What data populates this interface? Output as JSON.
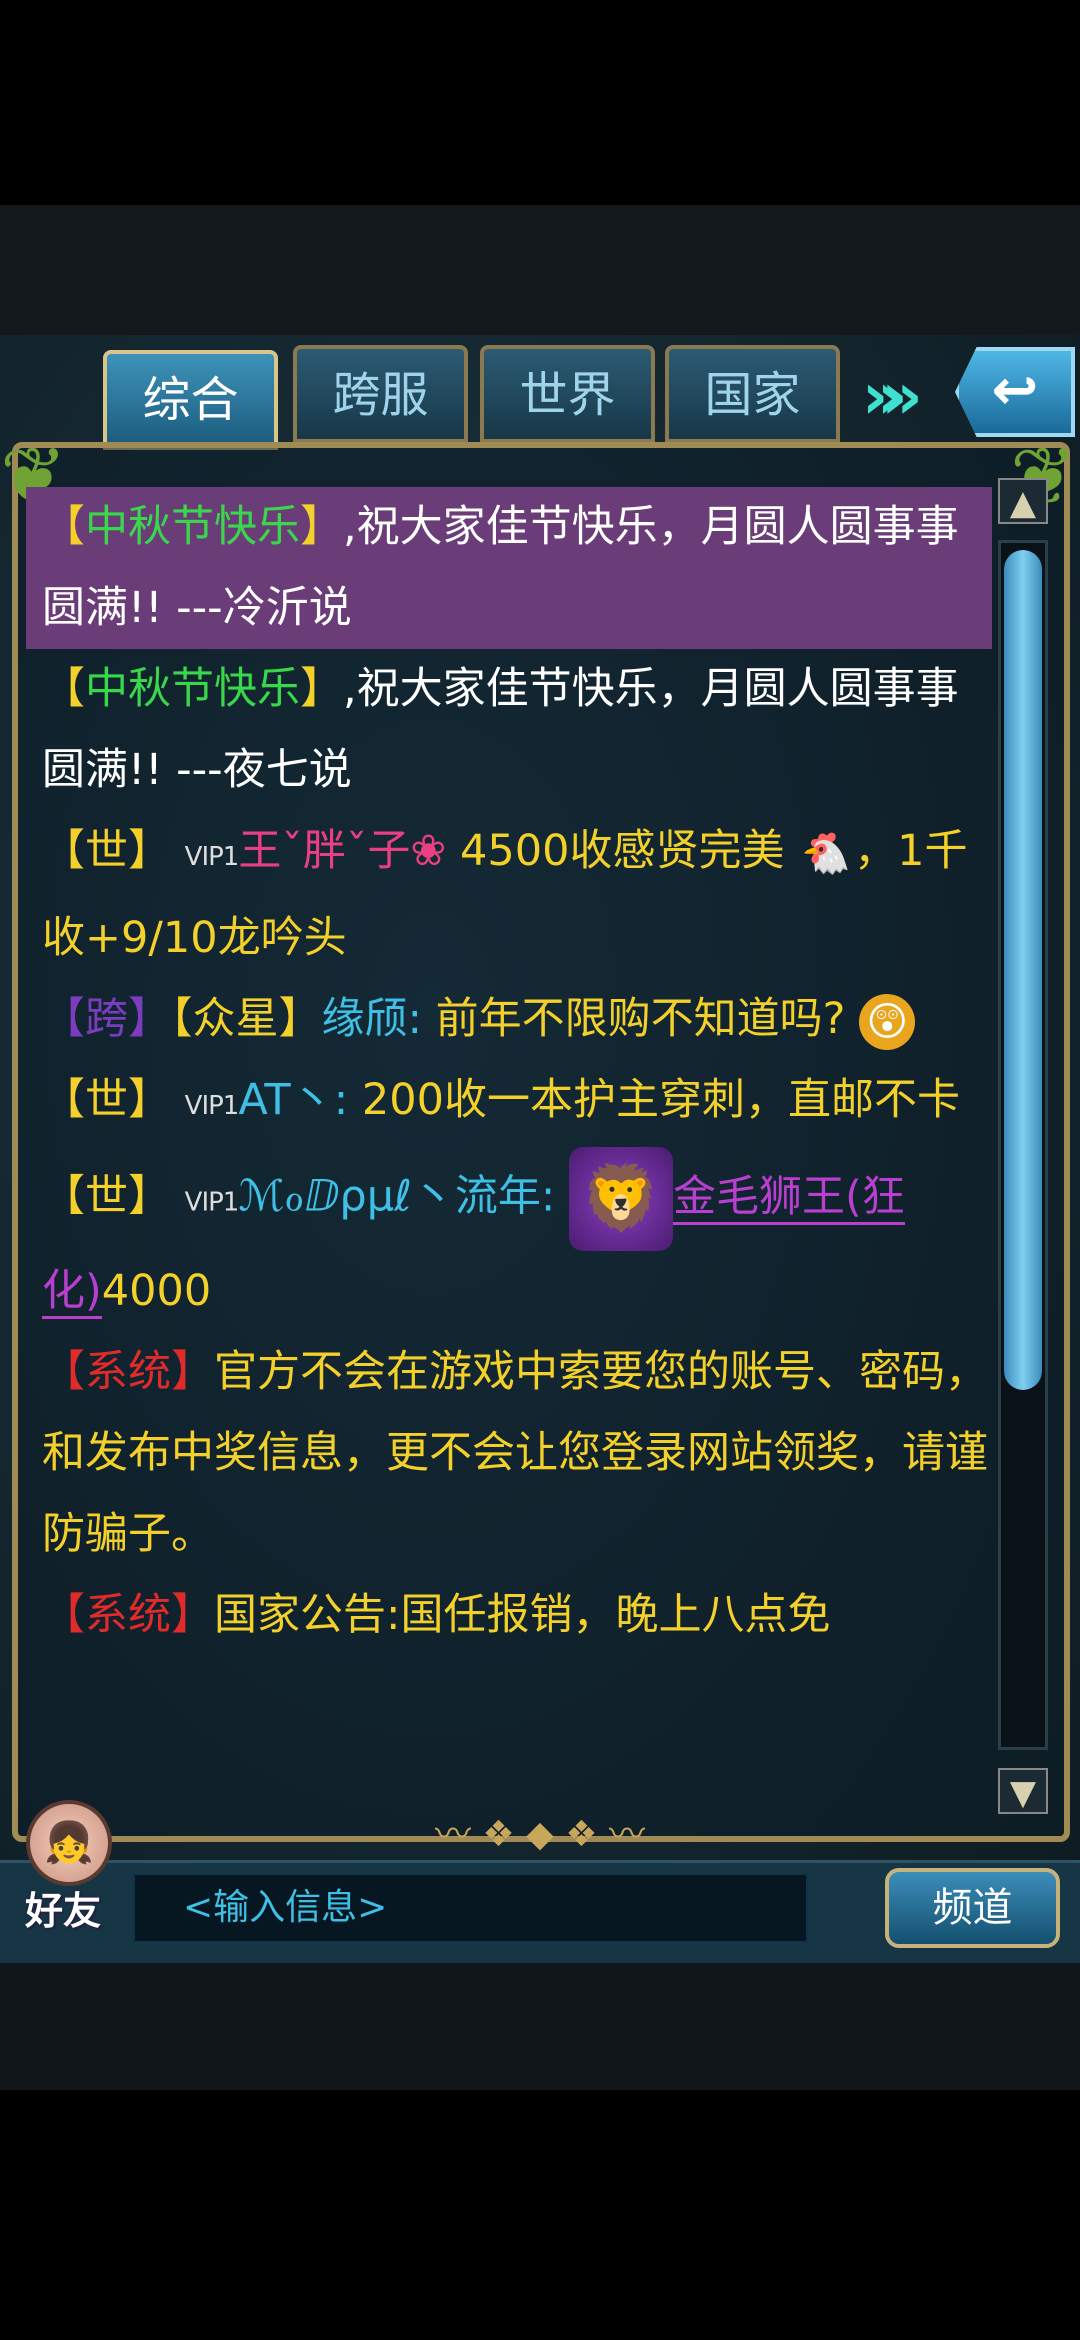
{
  "tabs": [
    {
      "label": "综合",
      "active": true
    },
    {
      "label": "跨服",
      "active": false
    },
    {
      "label": "世界",
      "active": false
    },
    {
      "label": "国家",
      "active": false
    }
  ],
  "header": {
    "arrows_icon": "double-chevron-right",
    "back_icon": "return-arrow"
  },
  "messages": [
    {
      "tag": "【中秋节快乐】",
      "rest": ",祝大家佳节快乐，月圆人圆事事圆满!! ---冷沂说",
      "highlight": true
    },
    {
      "tag": "【中秋节快乐】",
      "rest": ",祝大家佳节快乐，月圆人圆事事圆满!! ---夜七说"
    },
    {
      "channel": "【世】",
      "vip": "VIP1",
      "name": "王ˇ胖ˇ子❀",
      "text": " 4500收感贤完美",
      "emoji": "🐔",
      "text2": "，1千收+9/10龙吟头"
    },
    {
      "channel": "【跨】",
      "guild": "【众星】",
      "name": "缘颀:",
      "text": " 前年不限购不知道吗?",
      "emoji": "😲"
    },
    {
      "channel": "【世】",
      "vip": "VIP1",
      "name": "AT丶:",
      "text": " 200收一本护主穿刺，直邮不卡"
    },
    {
      "channel": "【世】",
      "vip": "VIP1",
      "name": "ℳℴⅅρμℓ丶流年:",
      "pet_name": "金毛狮王(狂化)",
      "text": "4000"
    },
    {
      "channel": "【系统】",
      "text": "官方不会在游戏中索要您的账号、密码，和发布中奖信息，更不会让您登录网站领奖，请谨防骗子。"
    },
    {
      "channel": "【系统】",
      "text": "国家公告:国任报销，晚上八点免"
    }
  ],
  "bottom": {
    "friend_label": "好友",
    "input_placeholder": "<输入信息>",
    "channel_button": "频道"
  }
}
